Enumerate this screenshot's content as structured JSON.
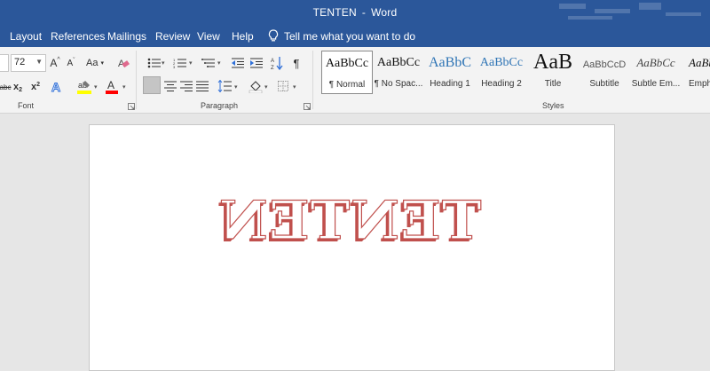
{
  "window": {
    "doc_title": "TENTEN",
    "separator": "-",
    "app_name": "Word"
  },
  "tabs": [
    "Layout",
    "References",
    "Mailings",
    "Review",
    "View",
    "Help"
  ],
  "tell_me": "Tell me what you want to do",
  "font_group": {
    "label": "Font",
    "size": "72",
    "grow_icon": "A^",
    "shrink_icon": "A˅",
    "case_icon": "Aa",
    "strike_icon": "abc",
    "sub_icon": "x₂",
    "sup_icon": "x²",
    "effects_icon": "A",
    "highlight_icon": "ab",
    "color_icon": "A",
    "highlight_color": "#ffff00",
    "font_color": "#ff0000"
  },
  "paragraph_group": {
    "label": "Paragraph",
    "pilcrow": "¶",
    "sort_icon": "A↓Z"
  },
  "styles_group": {
    "label": "Styles",
    "items": [
      {
        "sample": "AaBbCc",
        "name": "¶ Normal"
      },
      {
        "sample": "AaBbCc",
        "name": "¶ No Spac..."
      },
      {
        "sample": "AaBbC",
        "name": "Heading 1"
      },
      {
        "sample": "AaBbCc",
        "name": "Heading 2"
      },
      {
        "sample": "AaB",
        "name": "Title"
      },
      {
        "sample": "AaBbCcD",
        "name": "Subtitle"
      },
      {
        "sample": "AaBbCc",
        "name": "Subtle Em..."
      },
      {
        "sample": "AaBbCc",
        "name": "Emph"
      }
    ]
  },
  "document": {
    "content": "TENTEN",
    "text_outline_color": "#c0504d"
  },
  "colors": {
    "accent": "#2b579a",
    "ribbon_bg": "#f3f3f3",
    "doc_bg": "#e6e6e6",
    "heading_blue": "#2e74b5"
  }
}
